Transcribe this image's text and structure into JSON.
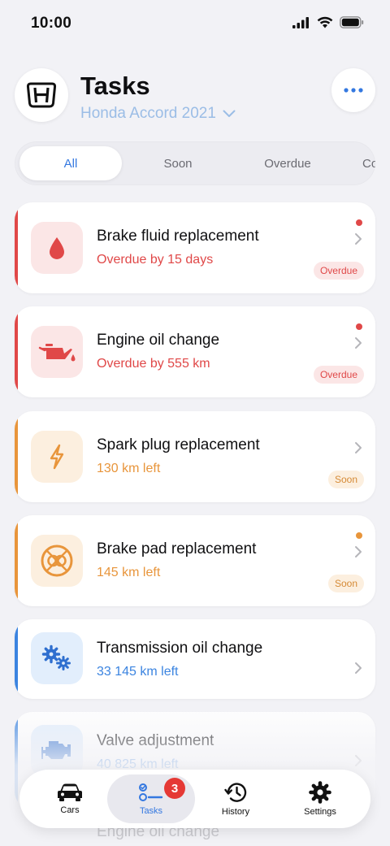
{
  "status_bar": {
    "time": "10:00"
  },
  "header": {
    "title": "Tasks",
    "car_name": "Honda Accord 2021"
  },
  "tabs": [
    "All",
    "Soon",
    "Overdue",
    "Co"
  ],
  "tasks": [
    {
      "title": "Brake fluid replacement",
      "status": "Overdue by 15 days",
      "badge": "Overdue",
      "icon": "drop-icon",
      "color": "#e04848"
    },
    {
      "title": "Engine oil change",
      "status": "Overdue by 555 km",
      "badge": "Overdue",
      "icon": "oil-can-icon",
      "color": "#e04848"
    },
    {
      "title": "Spark plug replacement",
      "status": "130 km left",
      "badge": "Soon",
      "icon": "lightning-icon",
      "color": "#e8953b"
    },
    {
      "title": "Brake pad replacement",
      "status": "145 km left",
      "badge": "Soon",
      "icon": "brake-pad-icon",
      "color": "#e8953b"
    },
    {
      "title": "Transmission oil change",
      "status": "33 145 km left",
      "icon": "gears-icon",
      "color": "#3b84e0"
    },
    {
      "title": "Valve adjustment",
      "status": "40 825 km left",
      "icon": "engine-icon",
      "color": "#3b84e0"
    },
    {
      "title": "Engine oil change"
    }
  ],
  "tabbar": {
    "items": [
      {
        "label": "Cars",
        "icon": "car-icon"
      },
      {
        "label": "Tasks",
        "icon": "tasks-icon",
        "badge": "3"
      },
      {
        "label": "History",
        "icon": "history-icon"
      },
      {
        "label": "Settings",
        "icon": "gear-icon"
      }
    ]
  },
  "colors": {
    "accent": "#3478e0",
    "overdue": "#e04848",
    "soon": "#e8953b",
    "info": "#3b84e0"
  }
}
